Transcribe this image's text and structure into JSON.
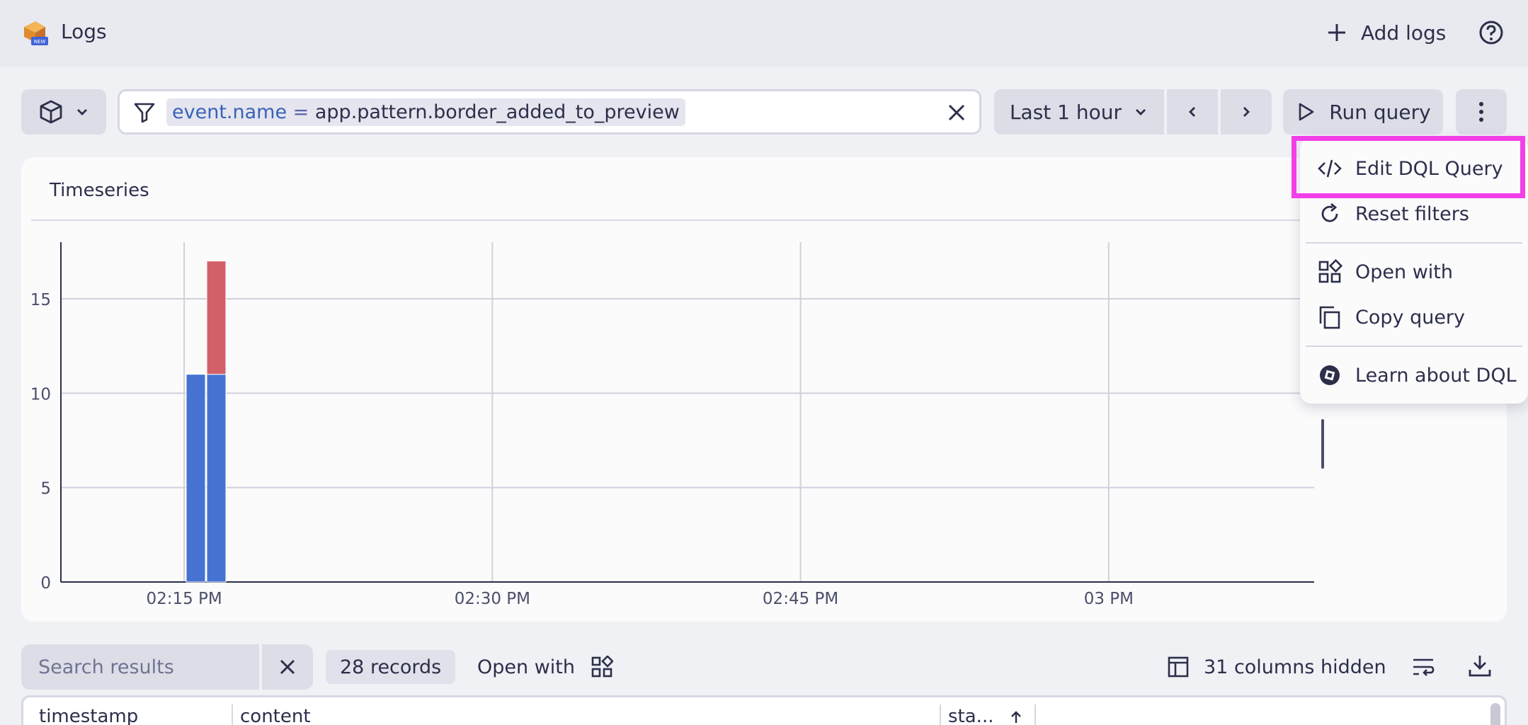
{
  "header": {
    "app_name": "Logs",
    "logo_badge": "NEW",
    "add_logs_label": "Add logs",
    "icons": {
      "add": "plus-icon",
      "help": "help-circle-icon"
    }
  },
  "toolbar": {
    "filter": {
      "key": "event.name",
      "operator": "=",
      "value": "app.pattern.border_added_to_preview"
    },
    "timeframe_label": "Last 1 hour",
    "run_query_label": "Run query"
  },
  "menu": {
    "items": [
      {
        "label": "Edit DQL Query",
        "icon": "code-icon",
        "highlighted": true
      },
      {
        "label": "Reset filters",
        "icon": "refresh-icon"
      },
      {
        "label": "Open with",
        "icon": "apps-grid-icon"
      },
      {
        "label": "Copy query",
        "icon": "copy-icon"
      },
      {
        "label": "Learn about DQL",
        "icon": "dql-logo-icon"
      }
    ]
  },
  "chart": {
    "title": "Timeseries"
  },
  "chart_data": {
    "type": "bar",
    "stacked": true,
    "y_ticks": [
      "0",
      "5",
      "10",
      "15"
    ],
    "ylim": [
      0,
      18
    ],
    "x_ticks": [
      "02:15 PM",
      "02:30 PM",
      "02:45 PM",
      "03 PM"
    ],
    "x_tick_minutes": [
      15,
      30,
      45,
      60
    ],
    "xlim_minutes": [
      9,
      70
    ],
    "bars": [
      {
        "minute": 15.1,
        "segments": [
          {
            "value": 11,
            "color": "#4673d1"
          }
        ]
      },
      {
        "minute": 16.1,
        "segments": [
          {
            "value": 11,
            "color": "#4673d1"
          },
          {
            "value": 6,
            "color": "#d36069"
          }
        ]
      }
    ],
    "grid": true
  },
  "results": {
    "search_placeholder": "Search results",
    "records_label": "28 records",
    "open_with_label": "Open with",
    "columns_hidden_label": "31 columns hidden",
    "columns": [
      "timestamp",
      "content",
      "sta..."
    ]
  }
}
